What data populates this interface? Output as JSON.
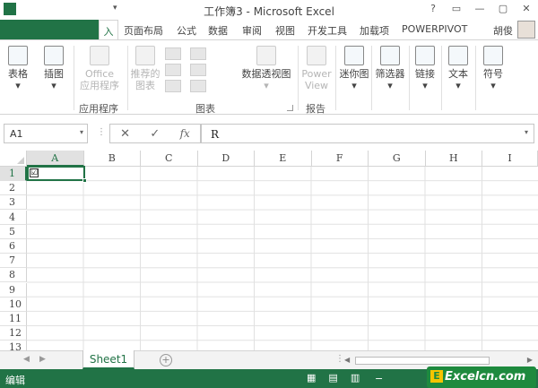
{
  "window": {
    "title": "工作簿3 - Microsoft Excel",
    "controls": [
      "?",
      "▭",
      "—",
      "▢",
      "✕"
    ]
  },
  "tabs": [
    "页面布局",
    "公式",
    "数据",
    "审阅",
    "视图",
    "开发工具",
    "加载项",
    "POWERPIVOT"
  ],
  "active_tab_fragment": "入",
  "user": "胡俊",
  "ribbon": {
    "table": "表格",
    "picture": "插图",
    "office_apps": [
      "Office",
      "应用程序"
    ],
    "recommended_charts": [
      "推荐的",
      "图表"
    ],
    "pivot_chart": "数据透视图",
    "power_view": [
      "Power",
      "View"
    ],
    "sparklines": "迷你图",
    "filter": "筛选器",
    "link": "链接",
    "text": "文本",
    "symbol": "符号",
    "groups": {
      "apps": "应用程序",
      "charts": "图表",
      "reports": "报告"
    }
  },
  "formula_bar": {
    "name_box": "A1",
    "fx": "fx",
    "cancel": "✕",
    "enter": "✓",
    "value": "R"
  },
  "grid": {
    "columns": [
      "A",
      "B",
      "C",
      "D",
      "E",
      "F",
      "G",
      "H",
      "I"
    ],
    "rows": [
      "1",
      "2",
      "3",
      "4",
      "5",
      "6",
      "7",
      "8",
      "9",
      "10",
      "11",
      "12",
      "13"
    ],
    "selected_cell": "A1",
    "cell_A1_symbol": "☑"
  },
  "sheets": [
    "Sheet1"
  ],
  "add_sheet": "+",
  "status": {
    "mode": "编辑"
  },
  "watermark": "Excelcn.com",
  "accent": "#217346"
}
